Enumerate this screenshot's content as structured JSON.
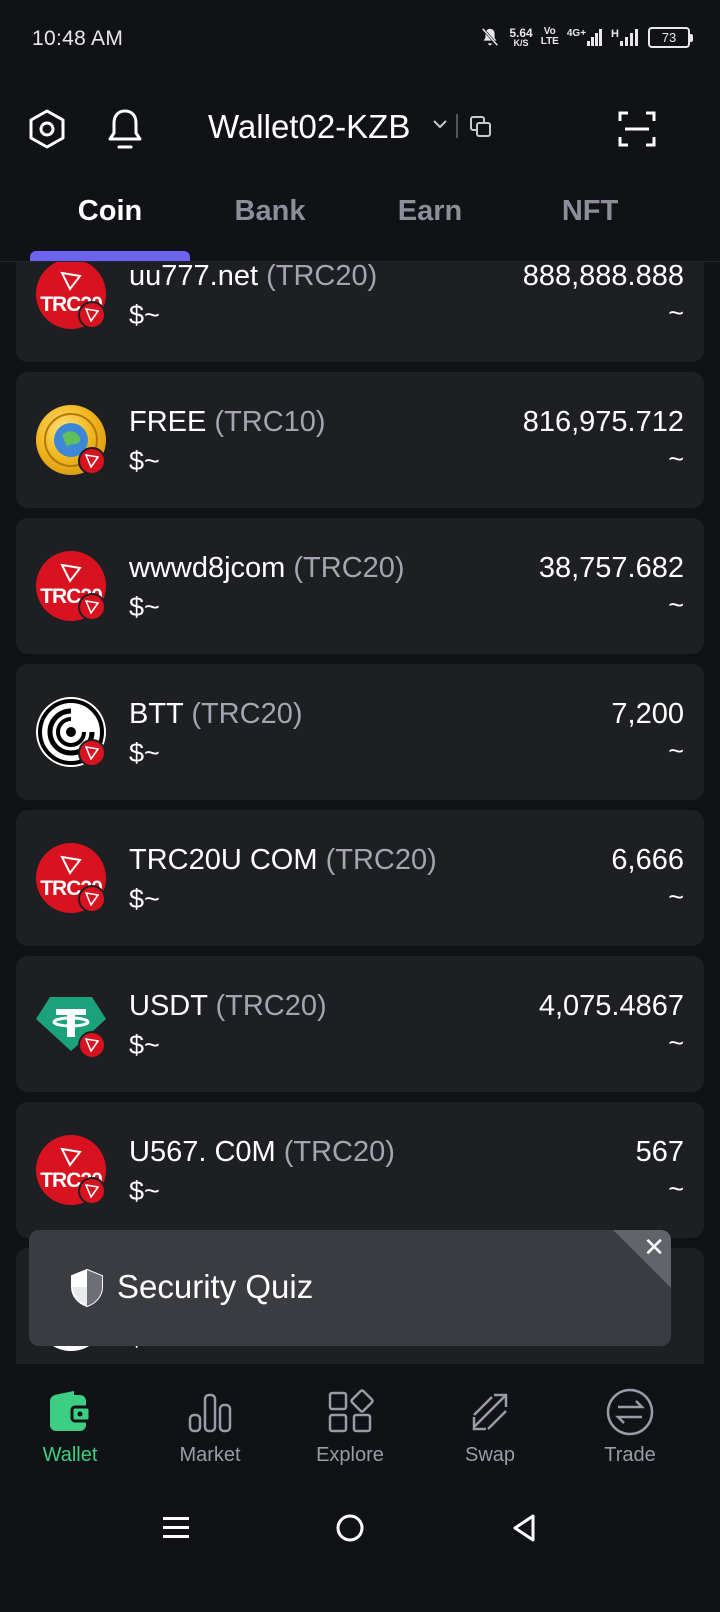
{
  "status_bar": {
    "time": "10:48 AM",
    "net_speed_value": "5.64",
    "net_speed_unit": "K/S",
    "volte_top": "Vo",
    "volte_bottom": "LTE",
    "network": "4G+",
    "signal2_label": "H",
    "battery": "73"
  },
  "header": {
    "wallet_name": "Wallet02-KZB",
    "settings_icon": "settings-hexagon-icon",
    "bell_icon": "bell-icon",
    "copy_icon": "copy-icon",
    "scan_icon": "scan-icon"
  },
  "tabs": [
    {
      "label": "Coin",
      "active": true
    },
    {
      "label": "Bank",
      "active": false
    },
    {
      "label": "Earn",
      "active": false
    },
    {
      "label": "NFT",
      "active": false
    }
  ],
  "coins": [
    {
      "name": "uu777.net",
      "standard": "(TRC20)",
      "fiat": "$~",
      "amount": "888,888.888",
      "amount_fiat": "~",
      "logo": "trc20-logo",
      "logo_text": "TRC20"
    },
    {
      "name": "FREE",
      "standard": "(TRC10)",
      "fiat": "$~",
      "amount": "816,975.712",
      "amount_fiat": "~",
      "logo": "free-coin-logo",
      "logo_text": ""
    },
    {
      "name": "wwwd8jcom",
      "standard": "(TRC20)",
      "fiat": "$~",
      "amount": "38,757.682",
      "amount_fiat": "~",
      "logo": "trc20-logo",
      "logo_text": "TRC20"
    },
    {
      "name": "BTT",
      "standard": "(TRC20)",
      "fiat": "$~",
      "amount": "7,200",
      "amount_fiat": "~",
      "logo": "btt-logo",
      "logo_text": ""
    },
    {
      "name": "TRC20U COM",
      "standard": "(TRC20)",
      "fiat": "$~",
      "amount": "6,666",
      "amount_fiat": "~",
      "logo": "trc20-logo",
      "logo_text": "TRC20"
    },
    {
      "name": "USDT",
      "standard": "(TRC20)",
      "fiat": "$~",
      "amount": "4,075.4867",
      "amount_fiat": "~",
      "logo": "usdt-logo",
      "logo_text": ""
    },
    {
      "name": "U567. C0M",
      "standard": "(TRC20)",
      "fiat": "$~",
      "amount": "567",
      "amount_fiat": "~",
      "logo": "trc20-logo",
      "logo_text": "TRC20"
    },
    {
      "name": "",
      "standard": "",
      "fiat": "$",
      "amount": "",
      "amount_fiat": "",
      "logo": "partial-logo",
      "logo_text": ""
    }
  ],
  "security_quiz": {
    "title": "Security Quiz",
    "close_label": "✕"
  },
  "bottom_nav": [
    {
      "label": "Wallet",
      "icon": "wallet-icon",
      "active": true
    },
    {
      "label": "Market",
      "icon": "market-bars-icon",
      "active": false
    },
    {
      "label": "Explore",
      "icon": "explore-grid-icon",
      "active": false
    },
    {
      "label": "Swap",
      "icon": "swap-icon",
      "active": false
    },
    {
      "label": "Trade",
      "icon": "trade-icon",
      "active": false
    }
  ],
  "colors": {
    "background": "#111215",
    "card": "#1e1f23",
    "accent_tab": "#6c63f2",
    "accent_wallet": "#3ccf83",
    "tron_red": "#d8121f",
    "muted_text": "#8d8e99"
  }
}
